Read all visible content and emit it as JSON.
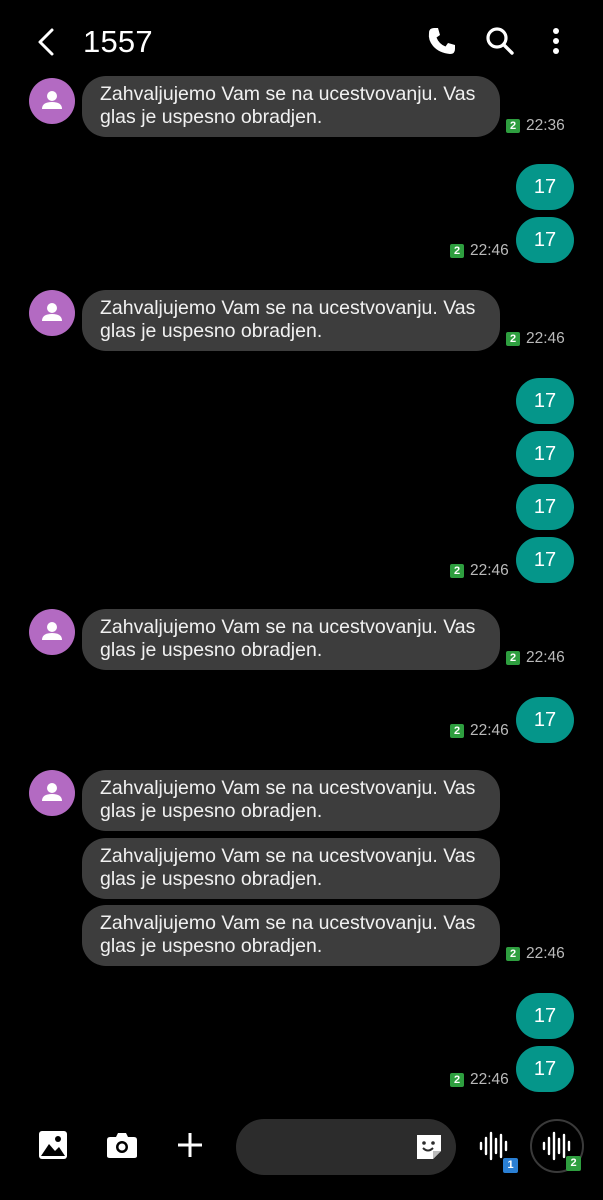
{
  "header": {
    "title": "1557",
    "back_icon": "chevron-left-icon",
    "call_icon": "phone-icon",
    "search_icon": "search-icon",
    "menu_icon": "more-vertical-icon"
  },
  "colors": {
    "background": "#000000",
    "incoming_bubble": "#3d3d3d",
    "outgoing_bubble": "#05968a",
    "avatar": "#b36ac2",
    "sim_badge": "#2e9e3f",
    "sim1_badge": "#2a7fd4"
  },
  "messages": [
    {
      "direction": "in",
      "text": "Zahvaljujemo Vam se na ucestvovanju. Vas glas je uspesno obradjen."
    },
    {
      "direction": "out",
      "text": "17"
    },
    {
      "direction": "out",
      "text": "17"
    },
    {
      "direction": "in",
      "text": "Zahvaljujemo Vam se na ucestvovanju. Vas glas je uspesno obradjen."
    },
    {
      "direction": "out",
      "text": "17"
    },
    {
      "direction": "out",
      "text": "17"
    },
    {
      "direction": "out",
      "text": "17"
    },
    {
      "direction": "out",
      "text": "17"
    },
    {
      "direction": "in",
      "text": "Zahvaljujemo Vam se na ucestvovanju. Vas glas je uspesno obradjen."
    },
    {
      "direction": "out",
      "text": "17"
    },
    {
      "direction": "in",
      "text": "Zahvaljujemo Vam se na ucestvovanju. Vas glas je uspesno obradjen."
    },
    {
      "direction": "in",
      "text": "Zahvaljujemo Vam se na ucestvovanju. Vas glas je uspesno obradjen."
    },
    {
      "direction": "in",
      "text": "Zahvaljujemo Vam se na ucestvovanju. Vas glas je uspesno obradjen."
    },
    {
      "direction": "out",
      "text": "17"
    },
    {
      "direction": "out",
      "text": "17"
    }
  ],
  "timestamps": [
    {
      "sim": "2",
      "time": "22:36"
    },
    {
      "sim": "2",
      "time": "22:46"
    },
    {
      "sim": "2",
      "time": "22:46"
    },
    {
      "sim": "2",
      "time": "22:46"
    },
    {
      "sim": "2",
      "time": "22:46"
    },
    {
      "sim": "2",
      "time": "22:46"
    },
    {
      "sim": "2",
      "time": "22:46"
    },
    {
      "sim": "2",
      "time": "22:46"
    }
  ],
  "composer": {
    "gallery_icon": "gallery-icon",
    "camera_icon": "camera-icon",
    "add_icon": "plus-icon",
    "sticker_icon": "sticker-icon",
    "voice_sim1_icon": "voice-wave-icon",
    "voice_sim1_badge": "1",
    "voice_sim2_icon": "voice-wave-icon",
    "voice_sim2_badge": "2"
  }
}
